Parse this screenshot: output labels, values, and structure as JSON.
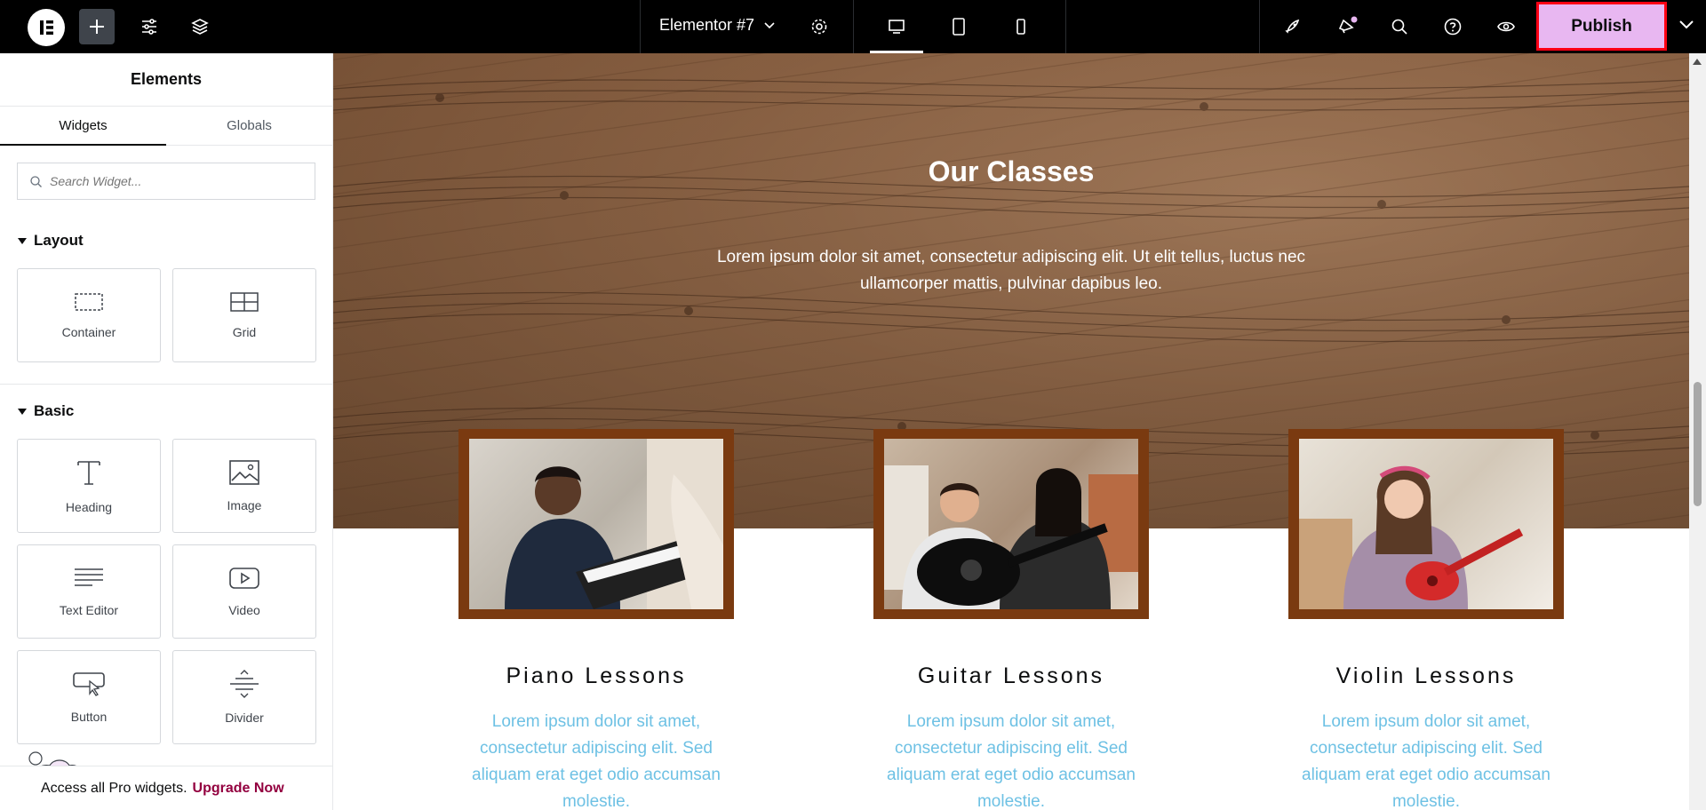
{
  "topbar": {
    "document_title": "Elementor #7",
    "publish_label": "Publish",
    "accent_color": "#e8b7f1",
    "highlight_color": "#ff0014"
  },
  "sidebar": {
    "title": "Elements",
    "tabs": [
      {
        "label": "Widgets",
        "active": true
      },
      {
        "label": "Globals",
        "active": false
      }
    ],
    "search_placeholder": "Search Widget...",
    "sections": [
      {
        "title": "Layout",
        "widgets": [
          {
            "label": "Container",
            "icon": "container-icon"
          },
          {
            "label": "Grid",
            "icon": "grid-icon"
          }
        ]
      },
      {
        "title": "Basic",
        "widgets": [
          {
            "label": "Heading",
            "icon": "heading-icon"
          },
          {
            "label": "Image",
            "icon": "image-icon"
          },
          {
            "label": "Text Editor",
            "icon": "text-editor-icon"
          },
          {
            "label": "Video",
            "icon": "video-icon"
          },
          {
            "label": "Button",
            "icon": "button-icon"
          },
          {
            "label": "Divider",
            "icon": "divider-icon"
          }
        ]
      }
    ],
    "promo_text": "Access all Pro widgets.",
    "promo_link": "Upgrade Now"
  },
  "canvas": {
    "hero_title": "Our Classes",
    "hero_text": "Lorem ipsum dolor sit amet, consectetur adipiscing elit. Ut elit tellus, luctus nec ullamcorper mattis, pulvinar dapibus leo.",
    "cards": [
      {
        "title": "Piano Lessons",
        "text": "Lorem ipsum dolor sit amet, consectetur adipiscing elit. Sed aliquam erat eget odio accumsan molestie."
      },
      {
        "title": "Guitar Lessons",
        "text": "Lorem ipsum dolor sit amet, consectetur adipiscing elit. Sed aliquam erat eget odio accumsan molestie."
      },
      {
        "title": "Violin Lessons",
        "text": "Lorem ipsum dolor sit amet, consectetur adipiscing elit. Sed aliquam erat eget odio accumsan molestie."
      }
    ],
    "frame_color": "#7a3a10",
    "card_text_color": "#6ec1e4"
  }
}
